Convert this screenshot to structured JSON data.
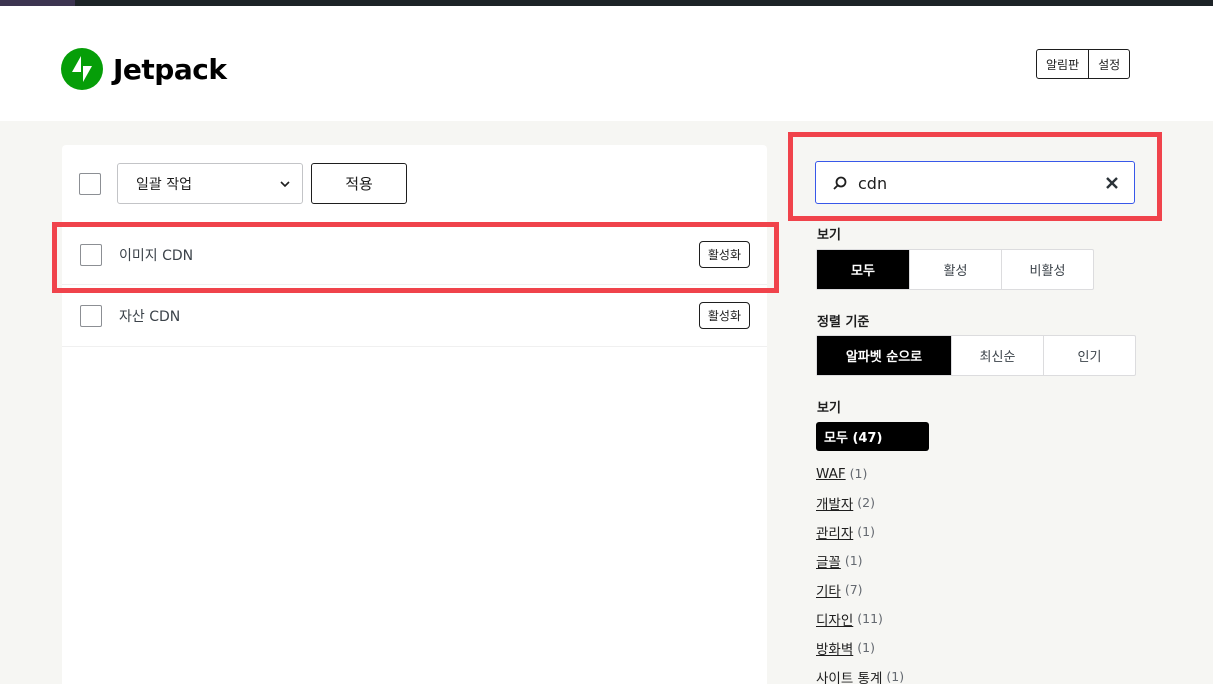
{
  "brand": {
    "name": "Jetpack",
    "color": "#069e08"
  },
  "header": {
    "buttons": [
      "알림판",
      "설정"
    ]
  },
  "toolbar": {
    "bulk_action": "일괄 작업",
    "apply": "적용"
  },
  "modules": [
    {
      "name": "이미지 CDN",
      "action": "활성화"
    },
    {
      "name": "자산 CDN",
      "action": "활성화"
    }
  ],
  "search": {
    "value": "cdn"
  },
  "view": {
    "title": "보기",
    "options": [
      "모두",
      "활성",
      "비활성"
    ],
    "active": "모두"
  },
  "sort": {
    "title": "정렬 기준",
    "options": [
      "알파벳 순으로",
      "최신순",
      "인기"
    ],
    "active": "알파벳 순으로"
  },
  "categories": {
    "title": "보기",
    "all_label": "모두 (47)",
    "items": [
      {
        "label": "WAF",
        "count": "(1)"
      },
      {
        "label": "개발자",
        "count": "(2)"
      },
      {
        "label": "관리자",
        "count": "(1)"
      },
      {
        "label": "글꼴",
        "count": "(1)"
      },
      {
        "label": "기타",
        "count": "(7)"
      },
      {
        "label": "디자인",
        "count": "(11)"
      },
      {
        "label": "방화벽",
        "count": "(1)"
      },
      {
        "label": "사이트 통계",
        "count": "(1)"
      }
    ]
  },
  "colors": {
    "highlight": "#f0434b",
    "focus": "#3858e9"
  }
}
